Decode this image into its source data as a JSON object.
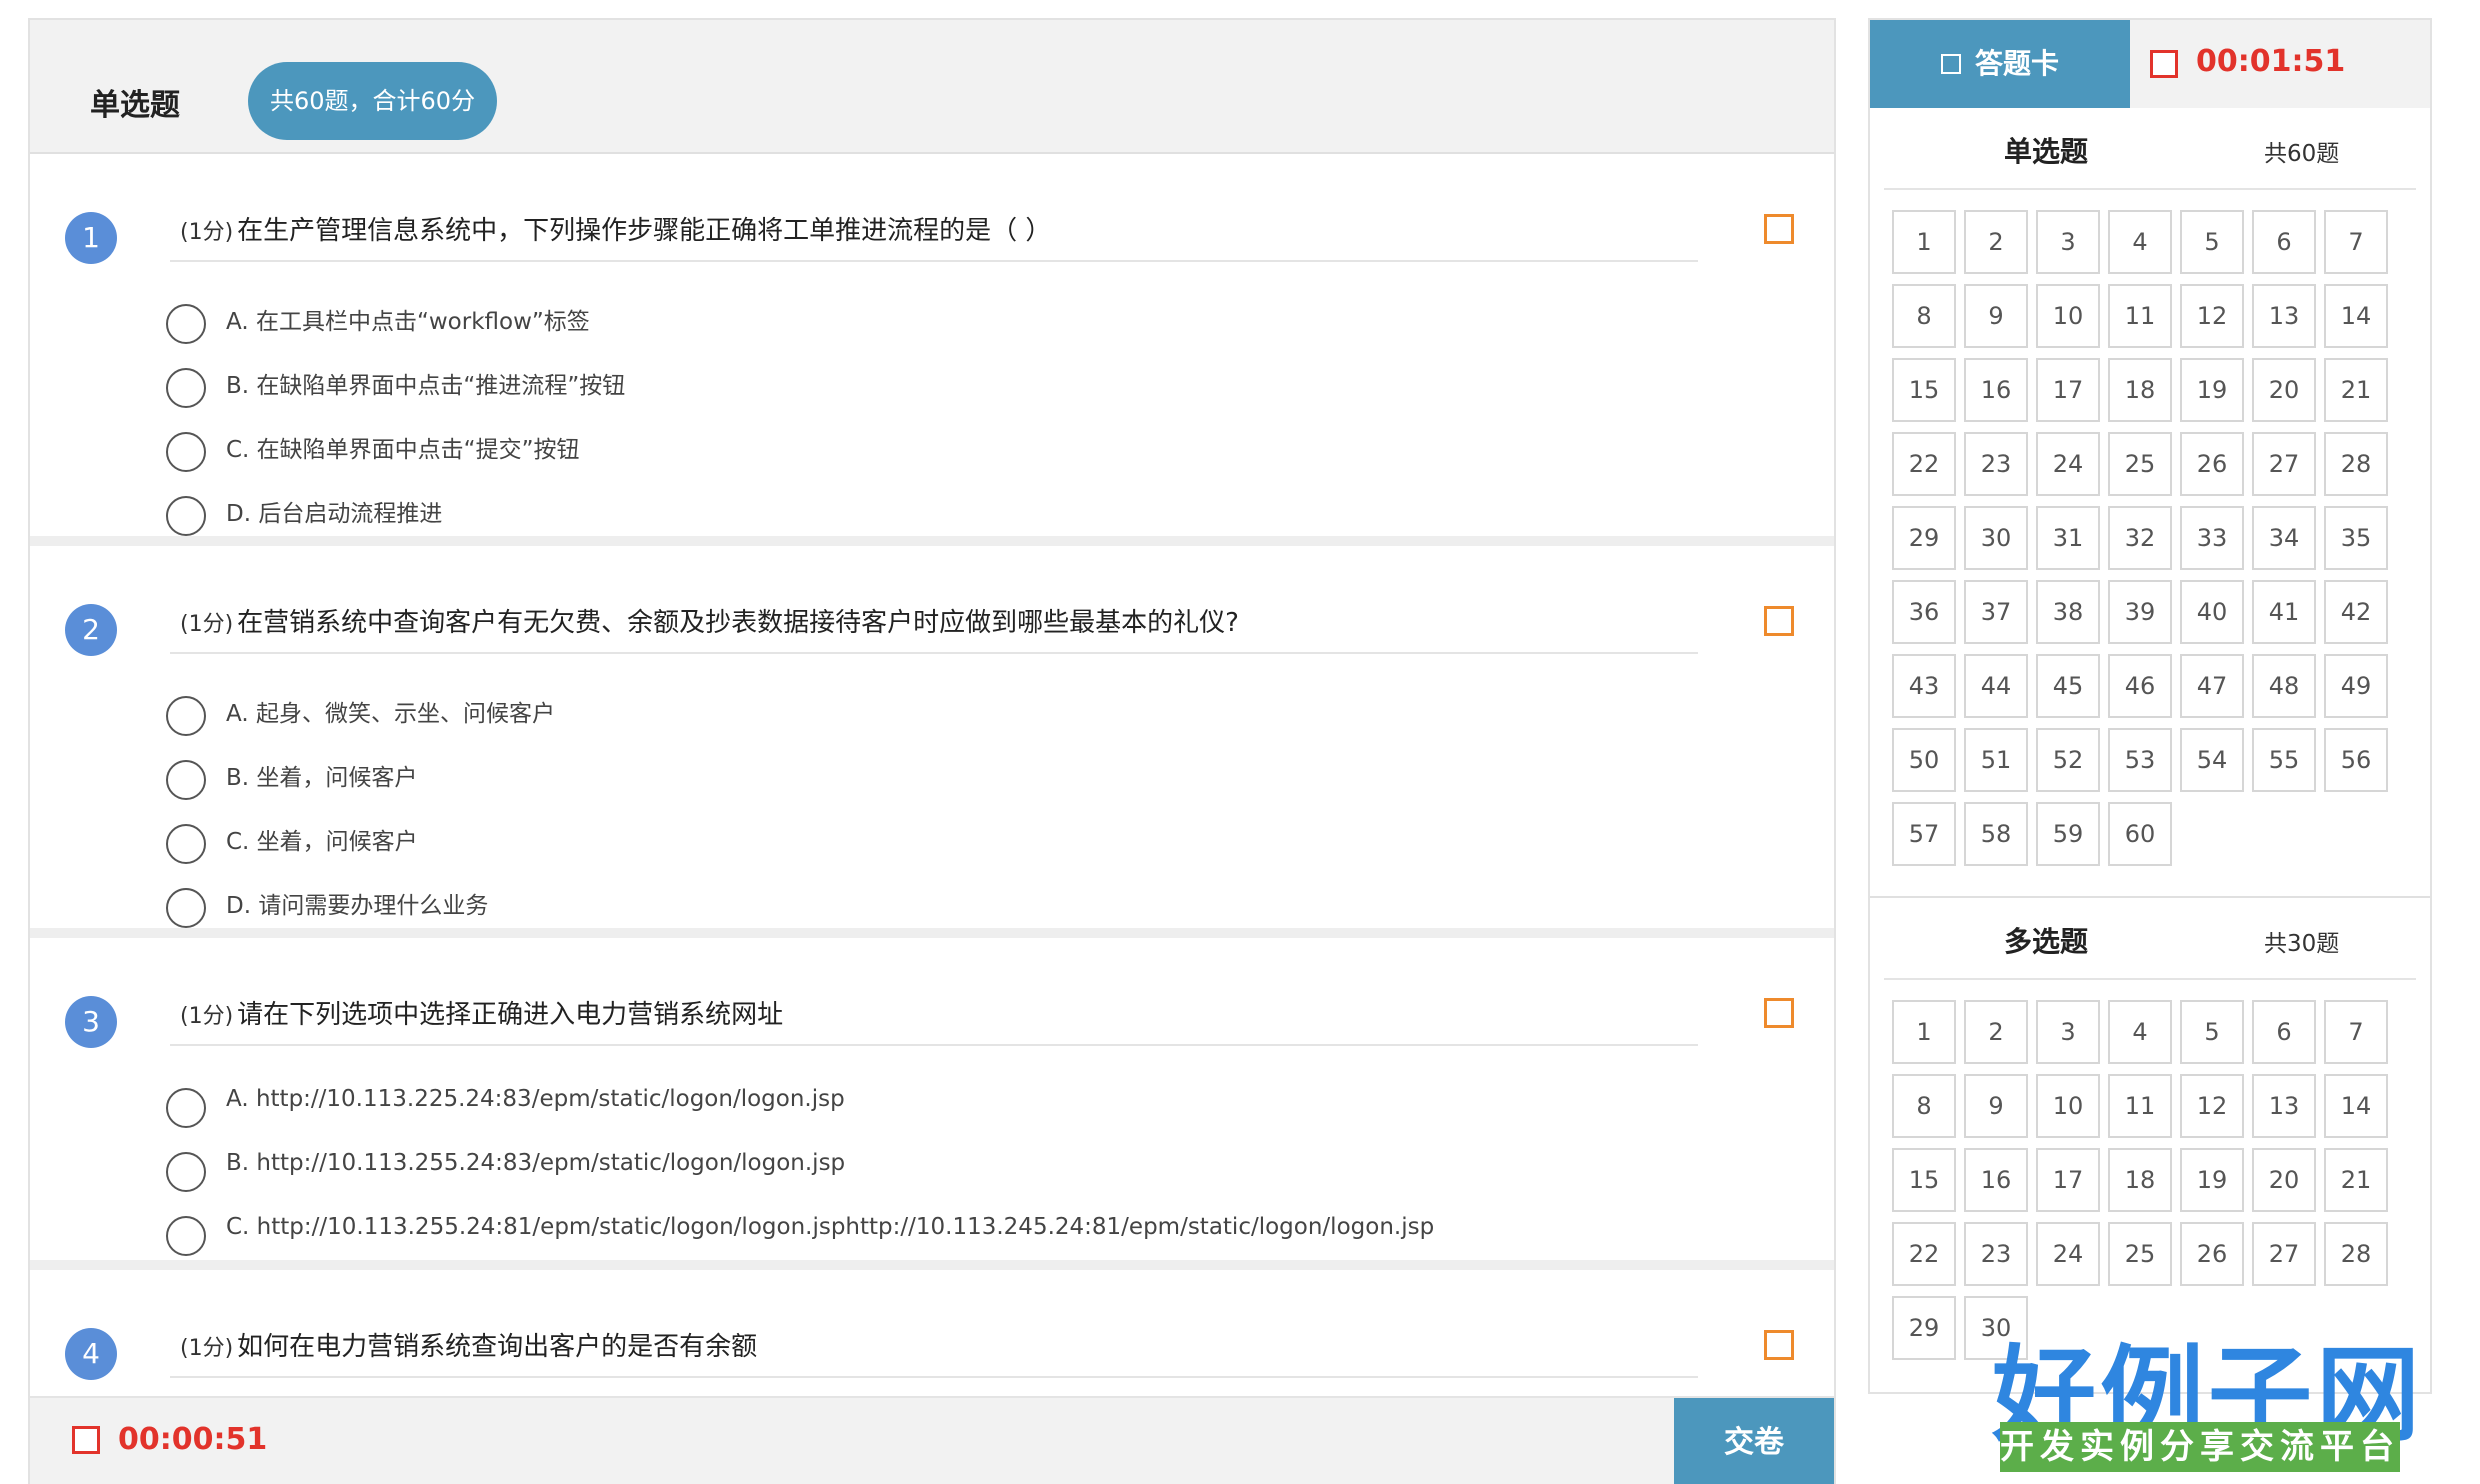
{
  "section": {
    "title": "单选题",
    "summary": "共60题，合计60分"
  },
  "questions": [
    {
      "number": "1",
      "points": "(1分)",
      "text": "在生产管理信息系统中，下列操作步骤能正确将工单推进流程的是（ ）",
      "options": [
        "A. 在工具栏中点击“workflow”标签",
        "B. 在缺陷单界面中点击“推进流程”按钮",
        "C. 在缺陷单界面中点击“提交”按钮",
        "D. 后台启动流程推进"
      ]
    },
    {
      "number": "2",
      "points": "(1分)",
      "text": "在营销系统中查询客户有无欠费、余额及抄表数据接待客户时应做到哪些最基本的礼仪?",
      "options": [
        "A. 起身、微笑、示坐、问候客户",
        "B. 坐着，问候客户",
        "C. 坐着，问候客户",
        "D. 请问需要办理什么业务"
      ]
    },
    {
      "number": "3",
      "points": "(1分)",
      "text": "请在下列选项中选择正确进入电力营销系统网址",
      "options": [
        "A. http://10.113.225.24:83/epm/static/logon/logon.jsp",
        "B. http://10.113.255.24:83/epm/static/logon/logon.jsp",
        "C. http://10.113.255.24:81/epm/static/logon/logon.jsphttp://10.113.245.24:81/epm/static/logon/logon.jsp"
      ]
    },
    {
      "number": "4",
      "points": "(1分)",
      "text": "如何在电力营销系统查询出客户的是否有余额",
      "options": []
    }
  ],
  "bottom_bar": {
    "timer": "00:00:51",
    "submit_label": "交卷"
  },
  "answer_card": {
    "tab_label": "答题卡",
    "timer": "00:01:51",
    "groups": [
      {
        "title": "单选题",
        "count": "共60题",
        "total": 60
      },
      {
        "title": "多选题",
        "count": "共30题",
        "total": 30
      }
    ]
  },
  "logo": {
    "main": "好例子网",
    "sub": "开发实例分享交流平台"
  },
  "colors": {
    "accent": "#4c97bd",
    "timer": "#e2332b",
    "flag": "#ee8a2c",
    "question_number": "#5a8ed8"
  }
}
